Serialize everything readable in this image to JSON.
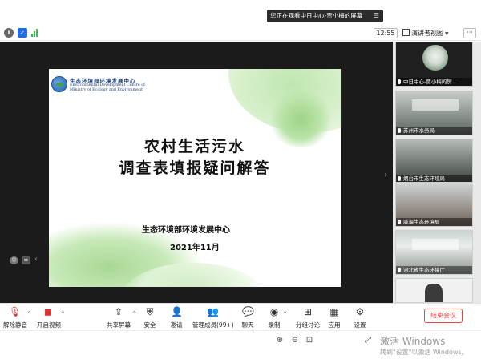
{
  "banner": {
    "text": "您正在观看中日中心-贾小梅的屏幕",
    "menu_icon": "menu-icon"
  },
  "info_bar": {
    "time": "12:55",
    "view_label": "演讲者视图",
    "more_label": "···",
    "icons": [
      "info-icon",
      "shield-icon",
      "signal-icon"
    ]
  },
  "slide": {
    "org_cn": "生态环境部环境发展中心",
    "org_en_1": "Environmental Development Centre of",
    "org_en_2": "Ministry of Ecology and Environment",
    "title_line1": "农村生活污水",
    "title_line2": "调查表填报疑问解答",
    "footer_org": "生态环境部环境发展中心",
    "date": "2021年11月"
  },
  "participants": [
    {
      "name": "中日中心-贾小梅的屏..."
    },
    {
      "name": "苏州市水务局"
    },
    {
      "name": "烟台市生态环境局"
    },
    {
      "name": "威海生态环境局"
    },
    {
      "name": "河北省生态环境厅"
    },
    {
      "name": ""
    }
  ],
  "toolbar": {
    "unmute": "解除静音",
    "video": "开启视频",
    "share": "共享屏幕",
    "security": "安全",
    "invite": "邀请",
    "members": "管理成员(99+)",
    "chat": "聊天",
    "record": "录制",
    "breakout": "分组讨论",
    "apps": "应用",
    "settings": "设置",
    "end_meeting": "结束会议"
  },
  "status_bar": {
    "watermark_title": "激活 Windows",
    "watermark_sub": "转到\"设置\"以激活 Windows。"
  },
  "colors": {
    "end_red": "#e84545",
    "accent_blue": "#1e6fe8",
    "signal_green": "#2fbf4a"
  }
}
